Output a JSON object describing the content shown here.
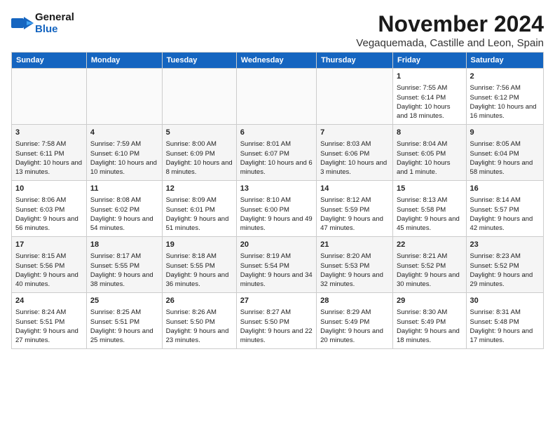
{
  "logo": {
    "line1": "General",
    "line2": "Blue"
  },
  "title": "November 2024",
  "subtitle": "Vegaquemada, Castille and Leon, Spain",
  "headers": [
    "Sunday",
    "Monday",
    "Tuesday",
    "Wednesday",
    "Thursday",
    "Friday",
    "Saturday"
  ],
  "weeks": [
    [
      {
        "day": "",
        "info": ""
      },
      {
        "day": "",
        "info": ""
      },
      {
        "day": "",
        "info": ""
      },
      {
        "day": "",
        "info": ""
      },
      {
        "day": "",
        "info": ""
      },
      {
        "day": "1",
        "info": "Sunrise: 7:55 AM\nSunset: 6:14 PM\nDaylight: 10 hours and 18 minutes."
      },
      {
        "day": "2",
        "info": "Sunrise: 7:56 AM\nSunset: 6:12 PM\nDaylight: 10 hours and 16 minutes."
      }
    ],
    [
      {
        "day": "3",
        "info": "Sunrise: 7:58 AM\nSunset: 6:11 PM\nDaylight: 10 hours and 13 minutes."
      },
      {
        "day": "4",
        "info": "Sunrise: 7:59 AM\nSunset: 6:10 PM\nDaylight: 10 hours and 10 minutes."
      },
      {
        "day": "5",
        "info": "Sunrise: 8:00 AM\nSunset: 6:09 PM\nDaylight: 10 hours and 8 minutes."
      },
      {
        "day": "6",
        "info": "Sunrise: 8:01 AM\nSunset: 6:07 PM\nDaylight: 10 hours and 6 minutes."
      },
      {
        "day": "7",
        "info": "Sunrise: 8:03 AM\nSunset: 6:06 PM\nDaylight: 10 hours and 3 minutes."
      },
      {
        "day": "8",
        "info": "Sunrise: 8:04 AM\nSunset: 6:05 PM\nDaylight: 10 hours and 1 minute."
      },
      {
        "day": "9",
        "info": "Sunrise: 8:05 AM\nSunset: 6:04 PM\nDaylight: 9 hours and 58 minutes."
      }
    ],
    [
      {
        "day": "10",
        "info": "Sunrise: 8:06 AM\nSunset: 6:03 PM\nDaylight: 9 hours and 56 minutes."
      },
      {
        "day": "11",
        "info": "Sunrise: 8:08 AM\nSunset: 6:02 PM\nDaylight: 9 hours and 54 minutes."
      },
      {
        "day": "12",
        "info": "Sunrise: 8:09 AM\nSunset: 6:01 PM\nDaylight: 9 hours and 51 minutes."
      },
      {
        "day": "13",
        "info": "Sunrise: 8:10 AM\nSunset: 6:00 PM\nDaylight: 9 hours and 49 minutes."
      },
      {
        "day": "14",
        "info": "Sunrise: 8:12 AM\nSunset: 5:59 PM\nDaylight: 9 hours and 47 minutes."
      },
      {
        "day": "15",
        "info": "Sunrise: 8:13 AM\nSunset: 5:58 PM\nDaylight: 9 hours and 45 minutes."
      },
      {
        "day": "16",
        "info": "Sunrise: 8:14 AM\nSunset: 5:57 PM\nDaylight: 9 hours and 42 minutes."
      }
    ],
    [
      {
        "day": "17",
        "info": "Sunrise: 8:15 AM\nSunset: 5:56 PM\nDaylight: 9 hours and 40 minutes."
      },
      {
        "day": "18",
        "info": "Sunrise: 8:17 AM\nSunset: 5:55 PM\nDaylight: 9 hours and 38 minutes."
      },
      {
        "day": "19",
        "info": "Sunrise: 8:18 AM\nSunset: 5:55 PM\nDaylight: 9 hours and 36 minutes."
      },
      {
        "day": "20",
        "info": "Sunrise: 8:19 AM\nSunset: 5:54 PM\nDaylight: 9 hours and 34 minutes."
      },
      {
        "day": "21",
        "info": "Sunrise: 8:20 AM\nSunset: 5:53 PM\nDaylight: 9 hours and 32 minutes."
      },
      {
        "day": "22",
        "info": "Sunrise: 8:21 AM\nSunset: 5:52 PM\nDaylight: 9 hours and 30 minutes."
      },
      {
        "day": "23",
        "info": "Sunrise: 8:23 AM\nSunset: 5:52 PM\nDaylight: 9 hours and 29 minutes."
      }
    ],
    [
      {
        "day": "24",
        "info": "Sunrise: 8:24 AM\nSunset: 5:51 PM\nDaylight: 9 hours and 27 minutes."
      },
      {
        "day": "25",
        "info": "Sunrise: 8:25 AM\nSunset: 5:51 PM\nDaylight: 9 hours and 25 minutes."
      },
      {
        "day": "26",
        "info": "Sunrise: 8:26 AM\nSunset: 5:50 PM\nDaylight: 9 hours and 23 minutes."
      },
      {
        "day": "27",
        "info": "Sunrise: 8:27 AM\nSunset: 5:50 PM\nDaylight: 9 hours and 22 minutes."
      },
      {
        "day": "28",
        "info": "Sunrise: 8:29 AM\nSunset: 5:49 PM\nDaylight: 9 hours and 20 minutes."
      },
      {
        "day": "29",
        "info": "Sunrise: 8:30 AM\nSunset: 5:49 PM\nDaylight: 9 hours and 18 minutes."
      },
      {
        "day": "30",
        "info": "Sunrise: 8:31 AM\nSunset: 5:48 PM\nDaylight: 9 hours and 17 minutes."
      }
    ]
  ]
}
